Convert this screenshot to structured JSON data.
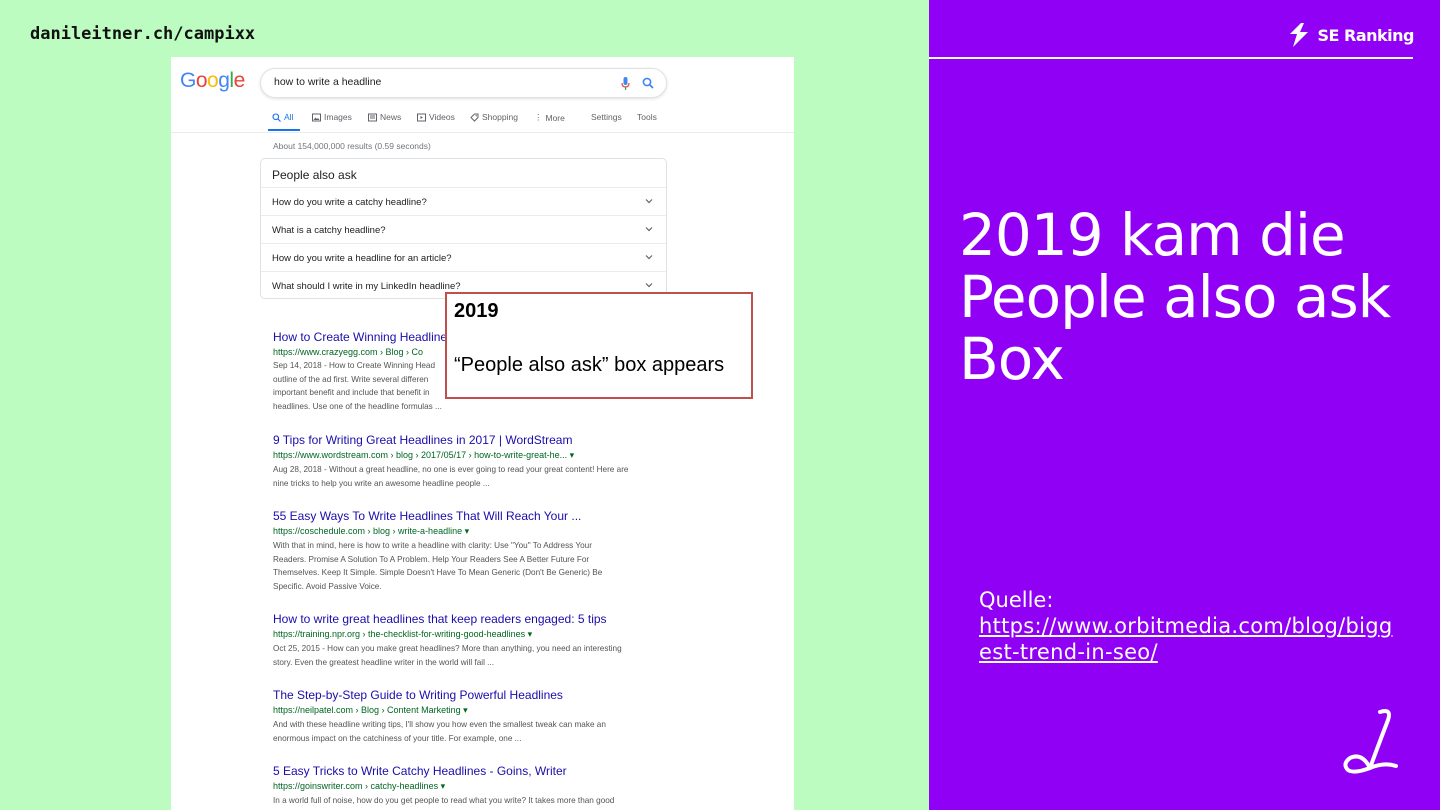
{
  "slide": {
    "site_url": "danileitner.ch/campixx",
    "brand": "SE Ranking",
    "headline_lines": [
      "2019 kam die",
      "People also ask",
      "Box"
    ],
    "source_label": "Quelle:",
    "source_link": "https://www.orbitmedia.com/blog/biggest-trend-in-seo/"
  },
  "serp": {
    "logo": "Google",
    "query": "how to write a headline",
    "tabs": [
      "All",
      "Images",
      "News",
      "Videos",
      "Shopping",
      "More",
      "Settings",
      "Tools"
    ],
    "stats": "About 154,000,000 results (0.59 seconds)",
    "paa_title": "People also ask",
    "paa_questions": [
      "How do you write a catchy headline?",
      "What is a catchy headline?",
      "How do you write a headline for an article?",
      "What should I write in my LinkedIn headline?"
    ],
    "results": [
      {
        "title": "How to Create Winning Headlines",
        "url": "https://www.crazyegg.com › Blog › Co",
        "snippet_lines": [
          "Sep 14, 2018 - How to Create Winning Head",
          "outline of the ad first. Write several differen",
          "important benefit and include that benefit in",
          "headlines. Use one of the headline formulas ..."
        ]
      },
      {
        "title": "9 Tips for Writing Great Headlines in 2017 | WordStream",
        "url": "https://www.wordstream.com › blog › 2017/05/17 › how-to-write-great-he... ▾",
        "snippet_lines": [
          "Aug 28, 2018 - Without a great headline, no one is ever going to read your great content! Here are",
          "nine tricks to help you write an awesome headline people ..."
        ]
      },
      {
        "title": "55 Easy Ways To Write Headlines That Will Reach Your ...",
        "url": "https://coschedule.com › blog › write-a-headline ▾",
        "snippet_lines": [
          "With that in mind, here is how to write a headline with clarity: Use \"You\" To Address Your",
          "Readers. Promise A Solution To A Problem. Help Your Readers See A Better Future For",
          "Themselves. Keep It Simple. Simple Doesn't Have To Mean Generic (Don't Be Generic) Be",
          "Specific. Avoid Passive Voice."
        ]
      },
      {
        "title": "How to write great headlines that keep readers engaged: 5 tips",
        "url": "https://training.npr.org › the-checklist-for-writing-good-headlines ▾",
        "snippet_lines": [
          "Oct 25, 2015 - How can you make great headlines? More than anything, you need an interesting",
          "story. Even the greatest headline writer in the world will fail ..."
        ]
      },
      {
        "title": "The Step-by-Step Guide to Writing Powerful Headlines",
        "url": "https://neilpatel.com › Blog › Content Marketing ▾",
        "snippet_lines": [
          "And with these headline writing tips, I'll show you how even the smallest tweak can make an",
          "enormous impact on the catchiness of your title. For example, one ..."
        ]
      },
      {
        "title": "5 Easy Tricks to Write Catchy Headlines - Goins, Writer",
        "url": "https://goinswriter.com › catchy-headlines ▾",
        "snippet_lines": [
          "In a world full of noise, how do you get people to read what you write? It takes more than good"
        ]
      }
    ],
    "callout_year": "2019",
    "callout_text": "“People also ask” box appears"
  },
  "colors": {
    "left_bg": "#bdfcc0",
    "right_bg": "#9000f5",
    "callout_border": "#c0504d",
    "link_blue": "#1a0dab",
    "url_green": "#006621"
  }
}
